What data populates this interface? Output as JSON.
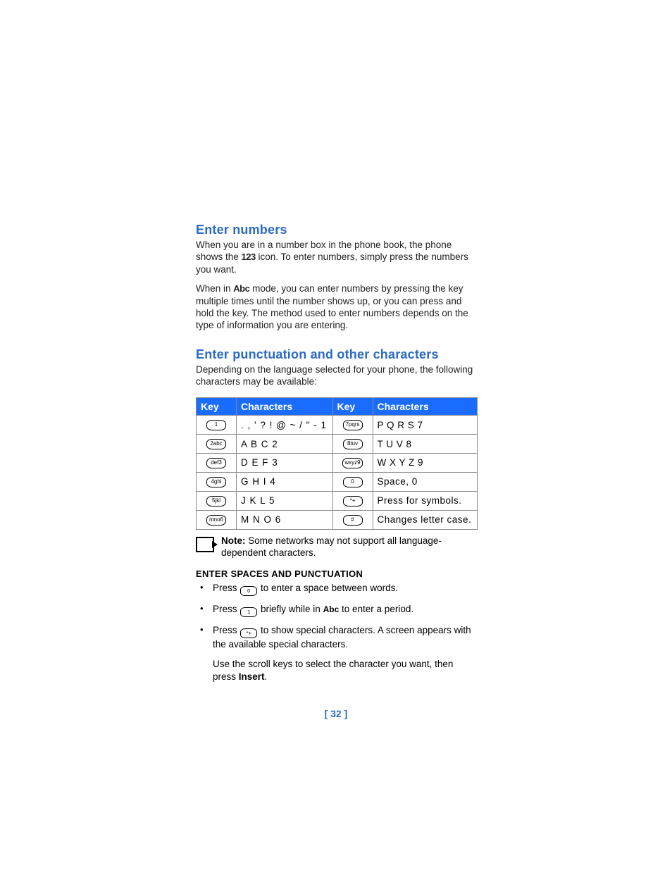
{
  "section1": {
    "heading": "Enter numbers",
    "para1_a": "When you are in a number box in the phone book, the phone shows the ",
    "mode_123": "123",
    "para1_b": " icon. To enter numbers, simply press the numbers you want.",
    "para2_a": "When in ",
    "mode_abc": "Abc",
    "para2_b": " mode, you can enter numbers by pressing the key multiple times until the number shows up, or you can press and hold the key. The method used to enter numbers depends on the type of information you are entering."
  },
  "section2": {
    "heading": "Enter punctuation and other characters",
    "intro": "Depending on the language selected for your phone, the following characters may be available:"
  },
  "table": {
    "headers": {
      "key1": "Key",
      "chars1": "Characters",
      "key2": "Key",
      "chars2": "Characters"
    },
    "rows": [
      {
        "k1": "1",
        "c1": ". , ' ? ! @ ~ / \" - 1",
        "k2": "7pqrs",
        "c2": "P Q R S 7"
      },
      {
        "k1": "2abc",
        "c1": "A B C 2",
        "k2": "8tuv",
        "c2": "T U V 8"
      },
      {
        "k1": "def3",
        "c1": "D E F 3",
        "k2": "wxyz9",
        "c2": "W X Y Z 9"
      },
      {
        "k1": "4ghi",
        "c1": "G H I 4",
        "k2": "0",
        "c2": "Space, 0"
      },
      {
        "k1": "5jkl",
        "c1": "J K L 5",
        "k2": "*+",
        "c2": "Press for symbols."
      },
      {
        "k1": "mno6",
        "c1": "M N O 6",
        "k2": "#",
        "c2": "Changes letter case."
      }
    ]
  },
  "note": {
    "label": "Note:",
    "text": "Some networks may not support all language-dependent characters."
  },
  "spaces": {
    "heading": "ENTER SPACES AND PUNCTUATION",
    "b1_a": "Press ",
    "b1_key": "0",
    "b1_b": " to enter a space between words.",
    "b2_a": "Press ",
    "b2_key": "1",
    "b2_b": " briefly while in ",
    "b2_mode": "Abc",
    "b2_c": " to enter a period.",
    "b3_a": "Press ",
    "b3_key": "*+",
    "b3_b": " to show special characters. A screen appears with the available special characters.",
    "after_a": "Use the scroll keys to select the character you want, then press ",
    "after_strong": "Insert",
    "after_b": "."
  },
  "page_number": "[ 32 ]"
}
